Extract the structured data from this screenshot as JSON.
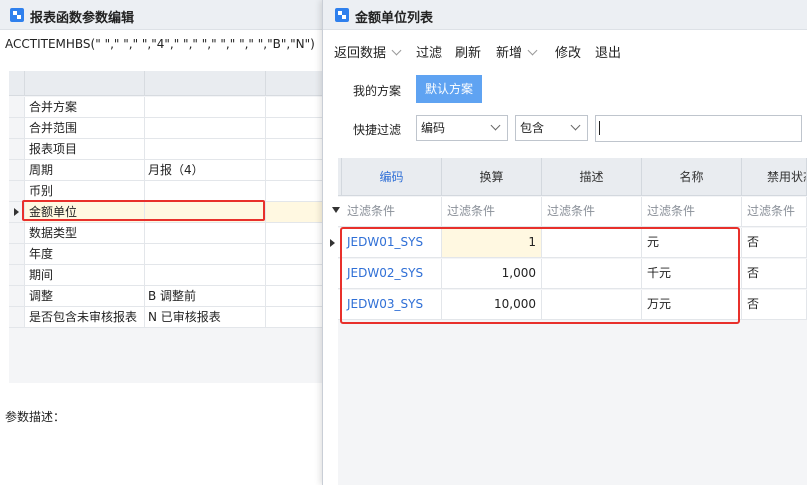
{
  "left_window": {
    "title": "报表函数参数编辑",
    "formula": "ACCTITEMHBS(\" \",\" \",\" \",\"4\",\" \",\" \",\" \",\" \",\" \",\"B\",\"N\")",
    "params": [
      {
        "name": "合并方案",
        "value": ""
      },
      {
        "name": "合并范围",
        "value": ""
      },
      {
        "name": "报表项目",
        "value": ""
      },
      {
        "name": "周期",
        "value": "月报（4）"
      },
      {
        "name": "币别",
        "value": ""
      },
      {
        "name": "金额单位",
        "value": ""
      },
      {
        "name": "数据类型",
        "value": ""
      },
      {
        "name": "年度",
        "value": ""
      },
      {
        "name": "期间",
        "value": ""
      },
      {
        "name": "调整",
        "value": "B  调整前"
      },
      {
        "name": "是否包含未审核报表",
        "value": "N  已审核报表"
      }
    ],
    "selected_param_index": 5,
    "description_label": "参数描述："
  },
  "right_window": {
    "title": "金额单位列表",
    "toolbar": {
      "return_data": "返回数据",
      "filter": "过滤",
      "refresh": "刷新",
      "add": "新增",
      "edit": "修改",
      "exit": "退出"
    },
    "filter_panel": {
      "my_scheme_label": "我的方案",
      "default_scheme": "默认方案",
      "quick_filter_label": "快捷过滤",
      "field_select": "编码",
      "operator_select": "包含",
      "search_value": ""
    },
    "grid": {
      "columns": [
        "编码",
        "换算",
        "描述",
        "名称",
        "禁用状态"
      ],
      "filter_placeholder": "过滤条件",
      "rows": [
        {
          "code": "JEDW01_SYS",
          "factor": "1",
          "desc": "",
          "name": "元",
          "disabled": "否"
        },
        {
          "code": "JEDW02_SYS",
          "factor": "1,000",
          "desc": "",
          "name": "千元",
          "disabled": "否"
        },
        {
          "code": "JEDW03_SYS",
          "factor": "10,000",
          "desc": "",
          "name": "万元",
          "disabled": "否"
        }
      ]
    }
  }
}
